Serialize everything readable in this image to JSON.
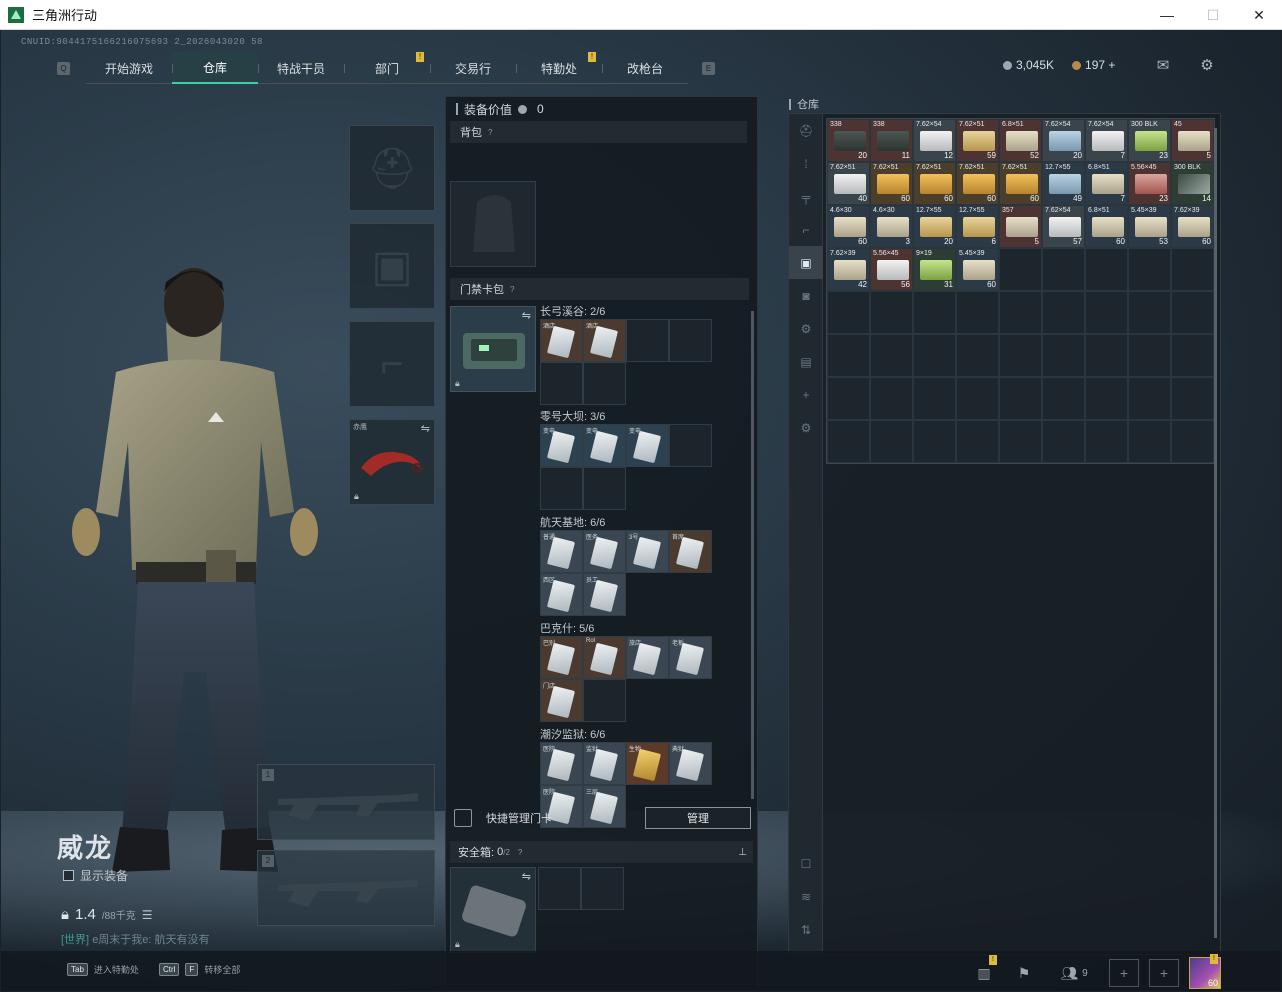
{
  "window": {
    "title": "三角洲行动",
    "minimize": "—",
    "maximize": "☐",
    "close": "✕"
  },
  "uid": "CNUID:9044175166216075693 2_2026043020 58",
  "nav": {
    "tabs": [
      {
        "label": "开始游戏",
        "active": false,
        "badge": false
      },
      {
        "label": "仓库",
        "active": true,
        "badge": false
      },
      {
        "label": "特战干员",
        "active": false,
        "badge": false
      },
      {
        "label": "部门",
        "active": false,
        "badge": true
      },
      {
        "label": "交易行",
        "active": false,
        "badge": false
      },
      {
        "label": "特勤处",
        "active": false,
        "badge": true
      },
      {
        "label": "改枪台",
        "active": false,
        "badge": false
      }
    ],
    "left_key": "Q",
    "right_key": "E",
    "badge_text": "!"
  },
  "currency": {
    "silver": "3,045K",
    "gold": "197",
    "gold_add": "+"
  },
  "operator": {
    "name": "威龙",
    "show_gear_label": "显示装备",
    "weight": "1.4",
    "weight_max": "/88千克",
    "chat_channel": "[世界]",
    "chat_text": "e周末于我e: 航天有没有"
  },
  "gear": {
    "melee_label": "赤鹰",
    "weapon1_num": "1",
    "weapon2_num": "2"
  },
  "middle": {
    "equip_value_label": "装备价值",
    "equip_value": "0",
    "backpack_label": "背包",
    "keycard_label": "门禁卡包",
    "help": "?",
    "regions": [
      {
        "title": "长弓溪谷: 2/6",
        "cards": [
          {
            "label": "酒店",
            "tone": "bronze"
          },
          {
            "label": "酒店",
            "tone": "bronze"
          },
          null,
          null,
          null,
          null
        ]
      },
      {
        "title": "零号大坝: 3/6",
        "cards": [
          {
            "label": "变电",
            "tone": "blue"
          },
          {
            "label": "变电",
            "tone": "blue"
          },
          {
            "label": "变电",
            "tone": "blue"
          },
          null,
          null,
          null
        ]
      },
      {
        "title": "航天基地: 6/6",
        "cards": [
          {
            "label": "普通",
            "tone": "card"
          },
          {
            "label": "医务",
            "tone": "card"
          },
          {
            "label": "3号",
            "tone": "card"
          },
          {
            "label": "首席",
            "tone": "bronze"
          },
          {
            "label": "西区",
            "tone": "card"
          },
          {
            "label": "员工",
            "tone": "card"
          }
        ]
      },
      {
        "title": "巴克什: 5/6",
        "cards": [
          {
            "label": "巴别",
            "tone": "bronze"
          },
          {
            "label": "Rol",
            "tone": "bronze"
          },
          {
            "label": "旅店",
            "tone": "card"
          },
          {
            "label": "老板",
            "tone": "card"
          },
          {
            "label": "门店",
            "tone": "bronze"
          },
          null
        ]
      },
      {
        "title": "潮汐监狱: 6/6",
        "cards": [
          {
            "label": "医院",
            "tone": "card"
          },
          {
            "label": "监狱",
            "tone": "card"
          },
          {
            "label": "生物",
            "tone": "gold"
          },
          {
            "label": "典狱",
            "tone": "card"
          },
          {
            "label": "医院",
            "tone": "card"
          },
          {
            "label": "三层",
            "tone": "card"
          }
        ]
      }
    ],
    "quick_manage_label": "快捷管理门卡",
    "manage_button": "管理",
    "safe_label": "安全箱:",
    "safe_value": "0",
    "safe_max": "/2"
  },
  "storage": {
    "title": "仓库",
    "side_tabs": [
      {
        "icon": "helmet-icon",
        "glyph": "⛑",
        "active": false
      },
      {
        "icon": "ammo-icon",
        "glyph": "⁞",
        "active": false
      },
      {
        "icon": "rifle-icon",
        "glyph": "╤",
        "active": false
      },
      {
        "icon": "pistol-icon",
        "glyph": "⌐",
        "active": false
      },
      {
        "icon": "ammo-box-icon",
        "glyph": "▣",
        "active": true
      },
      {
        "icon": "camera-icon",
        "glyph": "◙",
        "active": false
      },
      {
        "icon": "parts-icon",
        "glyph": "⚙",
        "active": false
      },
      {
        "icon": "case-icon",
        "glyph": "▤",
        "active": false
      },
      {
        "icon": "add-icon",
        "glyph": "+",
        "active": false
      },
      {
        "icon": "settings-icon",
        "glyph": "⚙",
        "active": false
      }
    ],
    "bottom_tabs": [
      {
        "icon": "portrait-icon",
        "glyph": "☐"
      },
      {
        "icon": "layers-icon",
        "glyph": "≋"
      },
      {
        "icon": "sort-icon",
        "glyph": "⇅"
      }
    ],
    "items": [
      {
        "cal": "338",
        "count": "20",
        "tone": "red",
        "box": "t-dark"
      },
      {
        "cal": "338",
        "count": "11",
        "tone": "red",
        "box": "t-dark"
      },
      {
        "cal": "7.62×54",
        "count": "12",
        "tone": "gray",
        "box": "t-white"
      },
      {
        "cal": "7.62×51",
        "count": "59",
        "tone": "red",
        "box": "t-tan"
      },
      {
        "cal": "6.8×51",
        "count": "52",
        "tone": "red",
        "box": "t-cream"
      },
      {
        "cal": "7.62×54",
        "count": "20",
        "tone": "gray",
        "box": "t-blue"
      },
      {
        "cal": "7.62×54",
        "count": "7",
        "tone": "gray",
        "box": "t-white"
      },
      {
        "cal": "300 BLK",
        "count": "23",
        "tone": "gray",
        "box": "t-green"
      },
      {
        "cal": "45",
        "count": "5",
        "tone": "red",
        "box": "t-cream"
      },
      {
        "cal": "7.62×51",
        "count": "40",
        "tone": "gray",
        "box": "t-white"
      },
      {
        "cal": "7.62×51",
        "count": "60",
        "tone": "gold",
        "box": "t-yellow"
      },
      {
        "cal": "7.62×51",
        "count": "60",
        "tone": "gold",
        "box": "t-yellow"
      },
      {
        "cal": "7.62×51",
        "count": "60",
        "tone": "gold",
        "box": "t-yellow"
      },
      {
        "cal": "7.62×51",
        "count": "60",
        "tone": "gold",
        "box": "t-yellow"
      },
      {
        "cal": "12.7×55",
        "count": "49",
        "tone": "blue",
        "box": "t-blue"
      },
      {
        "cal": "6.8×51",
        "count": "7",
        "tone": "blue",
        "box": "t-cream"
      },
      {
        "cal": "5.56×45",
        "count": "23",
        "tone": "red",
        "box": "t-red"
      },
      {
        "cal": "300 BLK",
        "count": "14",
        "tone": "green",
        "box": "t-gun"
      },
      {
        "cal": "4.6×30",
        "count": "60",
        "tone": "blue",
        "box": "t-cream"
      },
      {
        "cal": "4.6×30",
        "count": "3",
        "tone": "blue",
        "box": "t-cream"
      },
      {
        "cal": "12.7×55",
        "count": "20",
        "tone": "blue",
        "box": "t-tan"
      },
      {
        "cal": "12.7×55",
        "count": "6",
        "tone": "blue",
        "box": "t-tan"
      },
      {
        "cal": "357",
        "count": "5",
        "tone": "red",
        "box": "t-cream"
      },
      {
        "cal": "7.62×54",
        "count": "57",
        "tone": "gray",
        "box": "t-white"
      },
      {
        "cal": "6.8×51",
        "count": "60",
        "tone": "blue",
        "box": "t-cream"
      },
      {
        "cal": "5.45×39",
        "count": "53",
        "tone": "blue",
        "box": "t-cream"
      },
      {
        "cal": "7.62×39",
        "count": "60",
        "tone": "blue",
        "box": "t-cream"
      },
      {
        "cal": "7.62×39",
        "count": "42",
        "tone": "blue",
        "box": "t-cream"
      },
      {
        "cal": "5.56×45",
        "count": "56",
        "tone": "red",
        "box": "t-white"
      },
      {
        "cal": "9×19",
        "count": "31",
        "tone": "green",
        "box": "t-green"
      },
      {
        "cal": "5.45×39",
        "count": "60",
        "tone": "blue",
        "box": "t-cream"
      }
    ],
    "total_cells": 72
  },
  "bottom": {
    "hint1_key": "Tab",
    "hint1_text": "进入特勤处",
    "hint2_key1": "Ctrl",
    "hint2_key2": "F",
    "hint2_text": "转移全部",
    "friends_count": "9",
    "avatar_level": "60",
    "badge_text": "!"
  },
  "colors": {
    "accent": "#3ad0a3",
    "badge": "#e1b93c"
  }
}
